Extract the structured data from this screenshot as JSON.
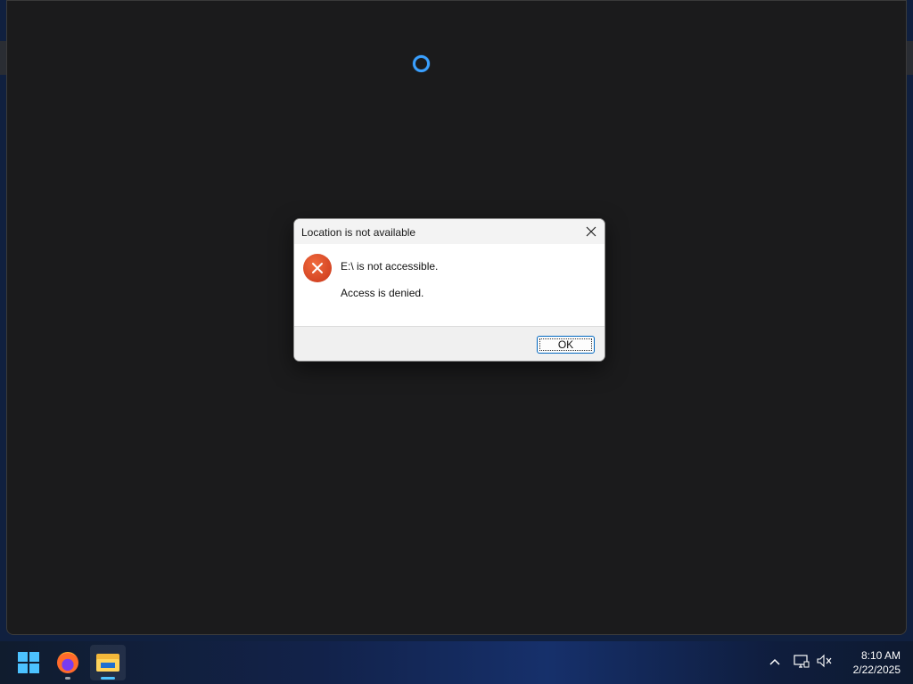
{
  "dialog": {
    "title": "Location is not available",
    "close_icon": "close-icon",
    "message_primary": "E:\\ is not accessible.",
    "message_secondary": "Access is denied.",
    "ok_label": "OK",
    "icon": "error-icon"
  },
  "taskbar": {
    "apps": [
      {
        "name": "Start",
        "icon": "windows-logo-icon"
      },
      {
        "name": "Firefox",
        "icon": "firefox-icon"
      },
      {
        "name": "File Explorer",
        "icon": "folder-icon"
      }
    ],
    "tray": {
      "chevron_icon": "chevron-up-icon",
      "network_icon": "network-icon",
      "volume_icon": "volume-muted-icon"
    },
    "clock": {
      "time": "8:10 AM",
      "date": "2/22/2025"
    }
  },
  "colors": {
    "accent": "#0067c0",
    "error": "#d9441f",
    "spinner": "#3aa0ff"
  }
}
